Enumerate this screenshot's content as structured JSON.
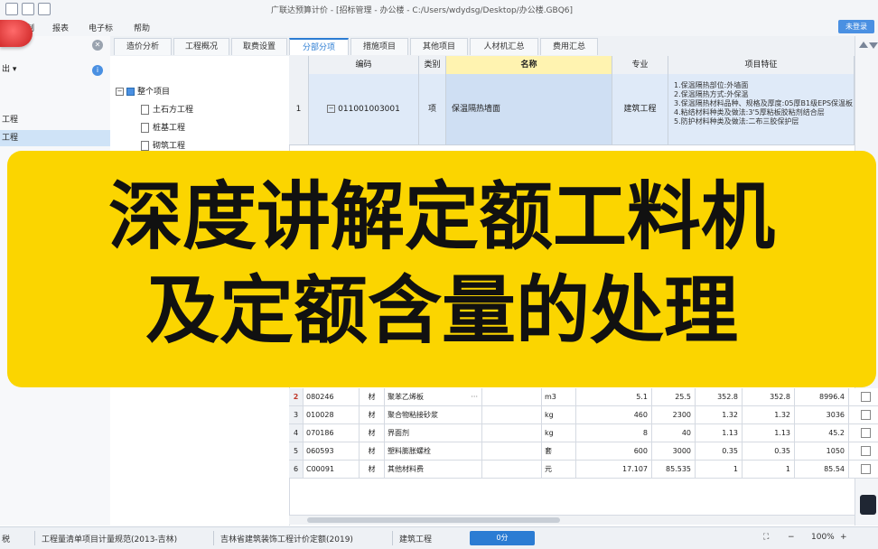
{
  "window": {
    "title": "广联达预算计价 - [招标管理 - 办公楼 - C:/Users/wdydsg/Desktop/办公楼.GBQ6]",
    "login_label": "未登录"
  },
  "menu": [
    "编制",
    "报表",
    "电子标",
    "帮助"
  ],
  "left_panel": {
    "toolbar_label": "出 ▾",
    "items": [
      "工程",
      "工程"
    ]
  },
  "tree": {
    "root": "整个项目",
    "children": [
      "土石方工程",
      "桩基工程",
      "砌筑工程"
    ]
  },
  "tabs": [
    "造价分析",
    "工程概况",
    "取费设置",
    "分部分项",
    "措施项目",
    "其他项目",
    "人材机汇总",
    "费用汇总"
  ],
  "active_tab": "分部分项",
  "grid": {
    "headers": [
      "编码",
      "类别",
      "名称",
      "专业",
      "项目特征"
    ],
    "row1": {
      "index": "1",
      "code": "011001003001",
      "category": "项",
      "name": "保温隔热墙面",
      "specialty": "建筑工程",
      "features": [
        "1.保温隔热部位:外墙面",
        "2.保温隔热方式:外保温",
        "3.保温隔热材料品种、规格及厚度:05厚B1级EPS保温板",
        "4.粘结材料种类及做法:3'5厚粘板胶粘剂结合层",
        "5.防护材料种类及做法:二布三胶保护层"
      ]
    }
  },
  "banner": {
    "line1": "深度讲解定额工料机",
    "line2": "及定额含量的处理"
  },
  "materials": [
    {
      "idx": "2",
      "code": "080246",
      "type": "材",
      "name": "聚苯乙烯板",
      "unit": "m3",
      "v1": "5.1",
      "v2": "25.5",
      "v3": "352.8",
      "v4": "352.8",
      "v5": "8996.4"
    },
    {
      "idx": "3",
      "code": "010028",
      "type": "材",
      "name": "聚合物粘接砂浆",
      "unit": "kg",
      "v1": "460",
      "v2": "2300",
      "v3": "1.32",
      "v4": "1.32",
      "v5": "3036"
    },
    {
      "idx": "4",
      "code": "070186",
      "type": "材",
      "name": "界面剂",
      "unit": "kg",
      "v1": "8",
      "v2": "40",
      "v3": "1.13",
      "v4": "1.13",
      "v5": "45.2"
    },
    {
      "idx": "5",
      "code": "060593",
      "type": "材",
      "name": "塑料膨胀螺栓",
      "unit": "套",
      "v1": "600",
      "v2": "3000",
      "v3": "0.35",
      "v4": "0.35",
      "v5": "1050"
    },
    {
      "idx": "6",
      "code": "C00091",
      "type": "材",
      "name": "其他材料费",
      "unit": "元",
      "v1": "17.107",
      "v2": "85.535",
      "v3": "1",
      "v4": "1",
      "v5": "85.54"
    }
  ],
  "statusbar": {
    "item1": "税",
    "item2": "工程量清单项目计量规范(2013-吉林)",
    "item3": "吉林省建筑装饰工程计价定额(2019)",
    "item4": "建筑工程",
    "item5": "0分",
    "zoom": "100%"
  }
}
